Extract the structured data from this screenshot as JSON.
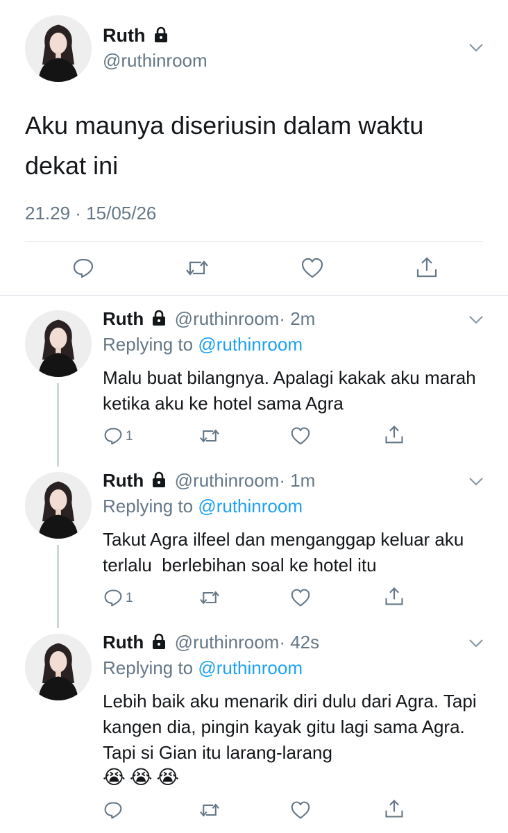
{
  "colors": {
    "link": "#1da1f2",
    "muted": "#657786",
    "text": "#14171a",
    "divider": "#e1e8ed"
  },
  "main_tweet": {
    "author_name": "Ruth",
    "author_handle": "@ruthinroom",
    "text": "Aku maunya diseriusin dalam waktu dekat ini",
    "timestamp": "21.29 · 15/05/26",
    "actions": [
      "reply-icon",
      "retweet-icon",
      "like-icon",
      "share-icon"
    ]
  },
  "replies": [
    {
      "name": "Ruth",
      "handle": "@ruthinroom",
      "time": "· 2m",
      "replying_label": "Replying to",
      "replying_handle": "@ruthinroom",
      "text": "Malu buat bilangnya. Apalagi kakak aku marah ketika aku ke hotel sama Agra",
      "reply_count": "1"
    },
    {
      "name": "Ruth",
      "handle": "@ruthinroom",
      "time": "· 1m",
      "replying_label": "Replying to",
      "replying_handle": "@ruthinroom",
      "text": "Takut Agra ilfeel dan menganggap keluar aku terlalu  berlebihan soal ke hotel itu",
      "reply_count": "1"
    },
    {
      "name": "Ruth",
      "handle": "@ruthinroom",
      "time": "· 42s",
      "replying_label": "Replying to",
      "replying_handle": "@ruthinroom",
      "text": "Lebih baik aku menarik diri dulu dari Agra. Tapi kangen dia, pingin kayak gitu lagi sama Agra. Tapi si Gian itu larang-larang",
      "emoji": "😭😭😭",
      "reply_count": ""
    }
  ]
}
